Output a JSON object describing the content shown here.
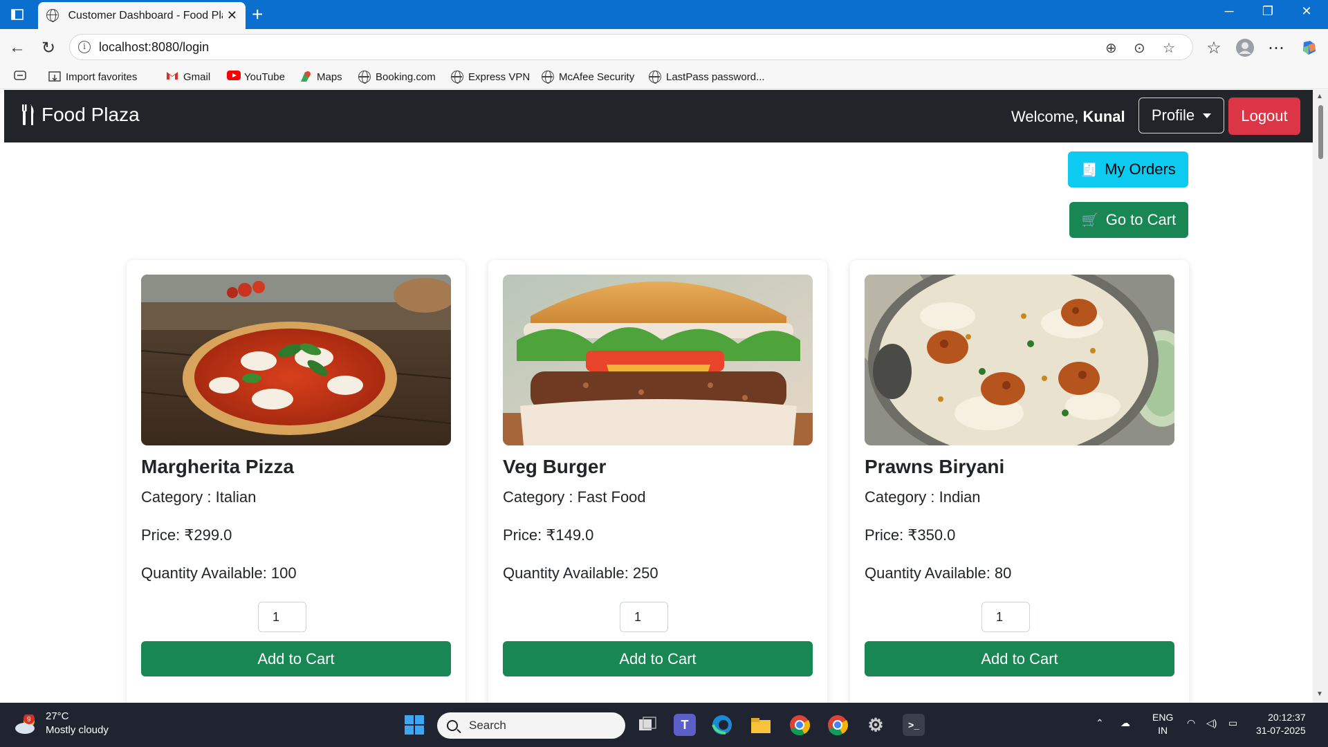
{
  "browser": {
    "tab_title": "Customer Dashboard - Food Plaza",
    "url": "localhost:8080/login",
    "favorites": [
      {
        "label": "Import favorites",
        "icon": "import-icon"
      },
      {
        "label": "Gmail",
        "icon": "gmail-icon"
      },
      {
        "label": "YouTube",
        "icon": "youtube-icon"
      },
      {
        "label": "Maps",
        "icon": "maps-icon"
      },
      {
        "label": "Booking.com",
        "icon": "globe-icon"
      },
      {
        "label": "Express VPN",
        "icon": "globe-icon"
      },
      {
        "label": "McAfee Security",
        "icon": "globe-icon"
      },
      {
        "label": "LastPass password...",
        "icon": "globe-icon"
      }
    ]
  },
  "navbar": {
    "brand": "Food Plaza",
    "welcome_prefix": "Welcome,",
    "user_name": "Kunal",
    "profile_label": "Profile",
    "logout_label": "Logout"
  },
  "actions": {
    "orders_icon": "🧾",
    "orders_label": "My Orders",
    "cart_icon": "🛒",
    "cart_label": "Go to Cart"
  },
  "products": [
    {
      "name": "Margherita Pizza",
      "category": "Category : Italian",
      "price": "Price: ₹299.0",
      "quantity": "Quantity Available: 100",
      "qty_value": "1",
      "add_label": "Add to Cart"
    },
    {
      "name": "Veg Burger",
      "category": "Category : Fast Food",
      "price": "Price: ₹149.0",
      "quantity": "Quantity Available: 250",
      "qty_value": "1",
      "add_label": "Add to Cart"
    },
    {
      "name": "Prawns Biryani",
      "category": "Category : Indian",
      "price": "Price: ₹350.0",
      "quantity": "Quantity Available: 80",
      "qty_value": "1",
      "add_label": "Add to Cart"
    }
  ],
  "taskbar": {
    "weather_badge": "9",
    "temperature": "27°C",
    "condition": "Mostly cloudy",
    "search_label": "Search",
    "lang_top": "ENG",
    "lang_bottom": "IN",
    "time": "20:12:37",
    "date": "31-07-2025"
  },
  "colors": {
    "navbar": "#212529",
    "success": "#198754",
    "info": "#0dcaf0",
    "danger": "#dc3545",
    "titlebar": "#0a6fcf"
  }
}
